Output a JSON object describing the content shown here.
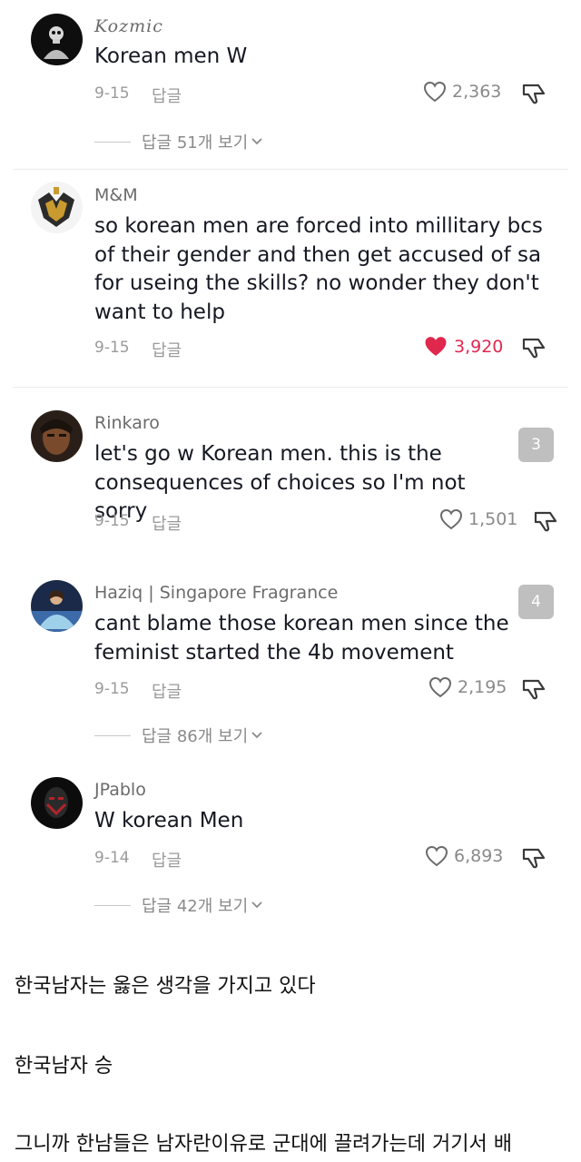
{
  "comments": [
    {
      "username": "Kozmic",
      "text": "Korean men W",
      "date": "9-15",
      "reply_label": "답글",
      "likes": "2,363",
      "liked": false,
      "view_replies": "답글 51개 보기"
    },
    {
      "username": "M&M",
      "text": "so korean men are forced into millitary bcs of their gender and then get accused of sa for useing the skills? no wonder they don't want to help",
      "date": "9-15",
      "reply_label": "답글",
      "likes": "3,920",
      "liked": true
    },
    {
      "username": "Rinkaro",
      "text": "let's go w Korean men. this is the consequences of choices so I'm not sorry",
      "date": "9-15",
      "reply_label": "답글",
      "likes": "1,501",
      "liked": false,
      "badge": "3"
    },
    {
      "username": "Haziq | Singapore Fragrance",
      "text": "cant blame those korean men since the feminist started the 4b movement",
      "date": "9-15",
      "reply_label": "답글",
      "likes": "2,195",
      "liked": false,
      "badge": "4",
      "view_replies": "답글 86개 보기"
    },
    {
      "username": "JPablo",
      "text": "W korean Men",
      "date": "9-14",
      "reply_label": "답글",
      "likes": "6,893",
      "liked": false,
      "view_replies": "답글 42개 보기"
    }
  ],
  "post": {
    "line1": "한국남자는 옳은 생각을 가지고 있다",
    "line2": "한국남자 승",
    "line3": "그니까 한남들은 남자란이유로 군대에 끌려가는데 거기서 배"
  },
  "colors": {
    "like_active": "#e0284f",
    "secondary_text": "#9a9a9a",
    "badge_bg": "#bfbfbf"
  },
  "icons": [
    "heart-outline-icon",
    "heart-filled-icon",
    "dislike-icon",
    "chevron-down-icon"
  ]
}
